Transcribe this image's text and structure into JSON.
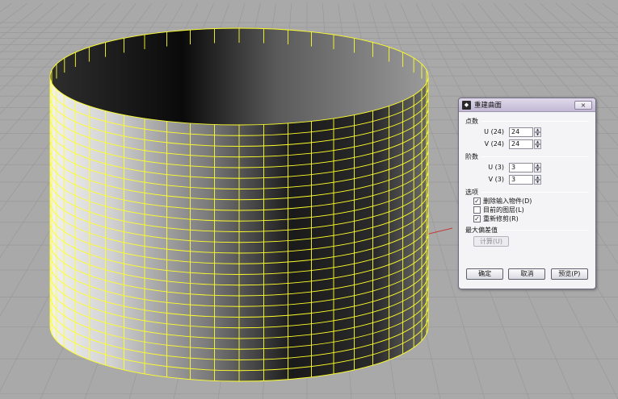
{
  "dialog": {
    "title": "重建曲面",
    "close_label": "×",
    "points_group": "点数",
    "u_points_label": "U (24)",
    "u_points_value": "24",
    "v_points_label": "V (24)",
    "v_points_value": "24",
    "degree_group": "阶数",
    "u_degree_label": "U (3)",
    "u_degree_value": "3",
    "v_degree_label": "V (3)",
    "v_degree_value": "3",
    "options_group": "选项",
    "options": [
      {
        "label": "删除输入物件(D)",
        "checked": true
      },
      {
        "label": "目前的图层(L)",
        "checked": false
      },
      {
        "label": "重新修剪(R)",
        "checked": true
      }
    ],
    "max_deviation_group": "最大偏差值",
    "calculate_label": "计算(U)",
    "ok_label": "确定",
    "cancel_label": "取消",
    "preview_label": "预览(P)"
  },
  "colors": {
    "viewport_bg": "#a9a9a9",
    "grid_line": "#969696",
    "wire": "#ffff2a",
    "axis_red": "#c23a3a"
  }
}
